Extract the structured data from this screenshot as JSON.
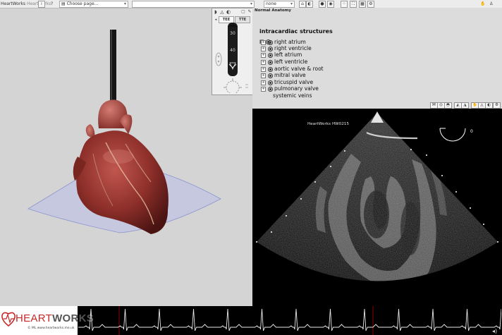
{
  "toolbar": {
    "app_name": "HeartWorks",
    "app_sub": "Heartworks",
    "help_glyph": "?",
    "page_select": "Choose page...",
    "mode_select": "none",
    "icons": [
      "grab-icon",
      "shoe-icon",
      "eye-icon",
      "record-icon",
      "camera-icon",
      "dotted-icon",
      "fit-icon",
      "layout-icon",
      "settings-icon",
      "hand-icon",
      "person-icon"
    ]
  },
  "probe": {
    "tabs": [
      "TEE",
      "TTE"
    ],
    "scale": [
      "30",
      "40"
    ]
  },
  "anatomy": {
    "bar_title": "Normal Anatomy",
    "heading": "intracardiac structures",
    "items": [
      {
        "label": "right atrium",
        "expandable": true
      },
      {
        "label": "right ventricle",
        "expandable": true
      },
      {
        "label": "left atrium",
        "expandable": true
      },
      {
        "label": "left ventricle",
        "expandable": true
      },
      {
        "label": "aortic valve & root",
        "expandable": true
      },
      {
        "label": "mitral valve",
        "expandable": true
      },
      {
        "label": "tricuspid valve",
        "expandable": true
      },
      {
        "label": "pulmonary valve",
        "expandable": true
      },
      {
        "label": "systemic veins",
        "expandable": false
      }
    ]
  },
  "ultrasound": {
    "label": "HeartWorks HW0215",
    "angle": "0"
  },
  "logo": {
    "part1": "HEART",
    "part2": "WORKS",
    "url": "© ML www.heartworks.me.uk"
  },
  "colors": {
    "accent_red": "#c62828",
    "heart": "#8e2f2a",
    "scan_plane": "#b9bee8"
  }
}
